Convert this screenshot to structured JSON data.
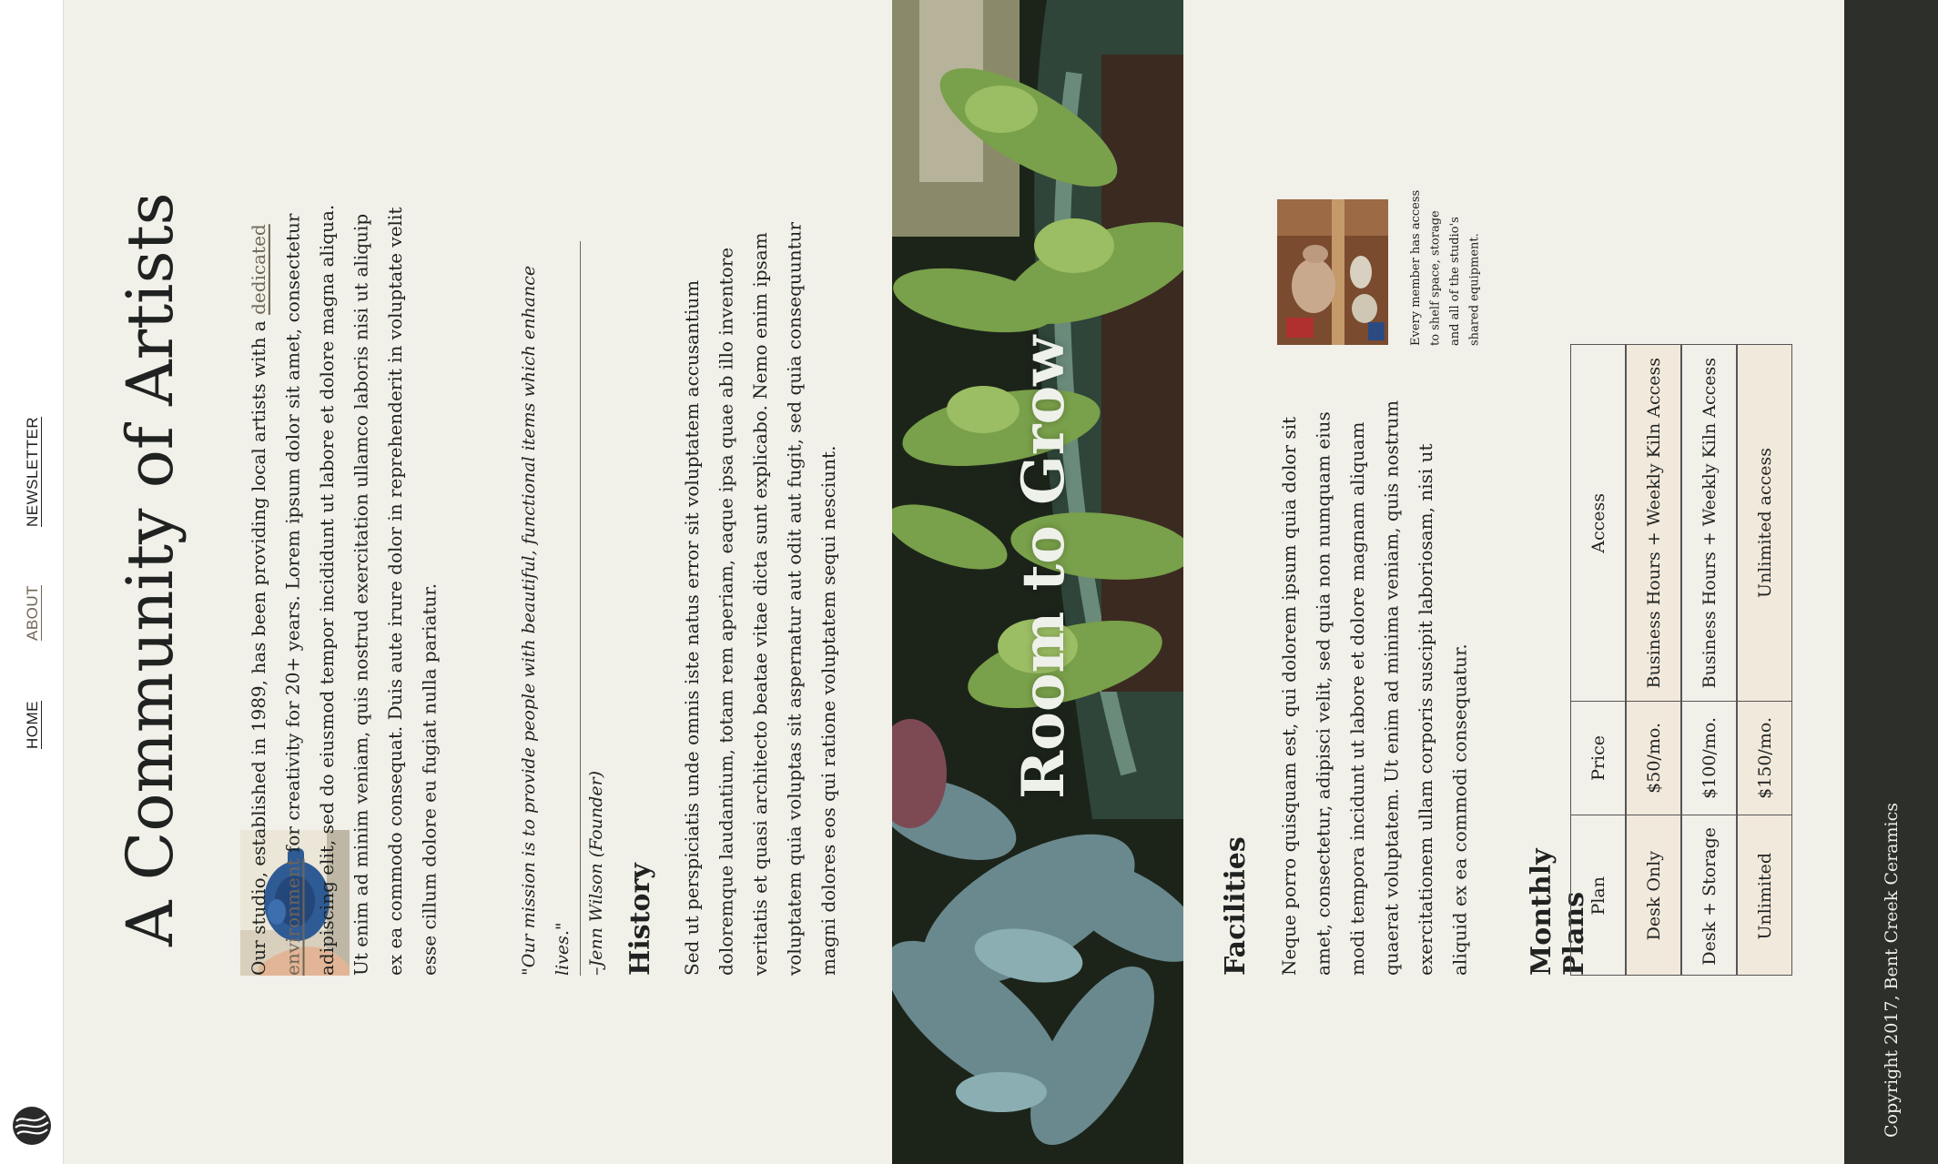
{
  "nav": {
    "home": "HOME",
    "about": "ABOUT",
    "newsletter": "NEWSLETTER"
  },
  "page_title": "A Community of Artists",
  "intro": {
    "before_link": "Our studio, established in 1989, has been providing local artists with a ",
    "link": "dedicated environment",
    "after_link": " for creativity for 20+ years. Lorem ipsum dolor sit amet, consectetur adipiscing elit, sed do eiusmod tempor incididunt ut labore et dolore magna aliqua. Ut enim ad minim veniam, quis nostrud exercitation ullamco laboris nisi ut aliquip ex ea commodo consequat. Duis aute irure dolor in reprehenderit in voluptate velit esse cillum dolore eu fugiat nulla pariatur."
  },
  "quote": {
    "text": "\"Our mission is to provide people with beautiful, functional items which enhance lives.\"",
    "author": "–Jenn Wilson (Founder)"
  },
  "history": {
    "heading": "History",
    "body": "Sed ut perspiciatis unde omnis iste natus error sit voluptatem accusantium doloremque laudantium, totam rem aperiam, eaque ipsa quae ab illo inventore veritatis et quasi architecto beatae vitae dicta sunt explicabo. Nemo enim ipsam voluptatem quia voluptas sit aspernatur aut odit aut fugit, sed quia consequuntur magni dolores eos qui ratione voluptatem sequi nesciunt."
  },
  "hero": {
    "title": "Room to Grow"
  },
  "facilities": {
    "heading": "Facilities",
    "body": "Neque porro quisquam est, qui dolorem ipsum quia dolor sit amet, consectetur, adipisci velit, sed quia non numquam eius modi tempora incidunt ut labore et dolore magnam aliquam quaerat voluptatem. Ut enim ad minima veniam, quis nostrum exercitationem ullam corporis suscipit laboriosam, nisi ut aliquid ex ea commodi consequatur.",
    "caption": "Every member has access to shelf space, storage and all of the studio's shared equipment."
  },
  "plans": {
    "heading": "Monthly Plans",
    "headers": [
      "Plan",
      "Price",
      "Access"
    ],
    "rows": [
      [
        "Desk Only",
        "$50/mo.",
        "Business Hours + Weekly Kiln Access"
      ],
      [
        "Desk + Storage",
        "$100/mo.",
        "Business Hours + Weekly Kiln Access"
      ],
      [
        "Unlimited",
        "$150/mo.",
        "Unlimited access"
      ]
    ]
  },
  "footer": {
    "copyright": "Copyright 2017, Bent Creek Ceramics"
  },
  "colors": {
    "background": "#f1f0e9",
    "accent": "#6f6556",
    "footer": "#2c2f2a",
    "highlight_row": "#f2e9dd"
  }
}
